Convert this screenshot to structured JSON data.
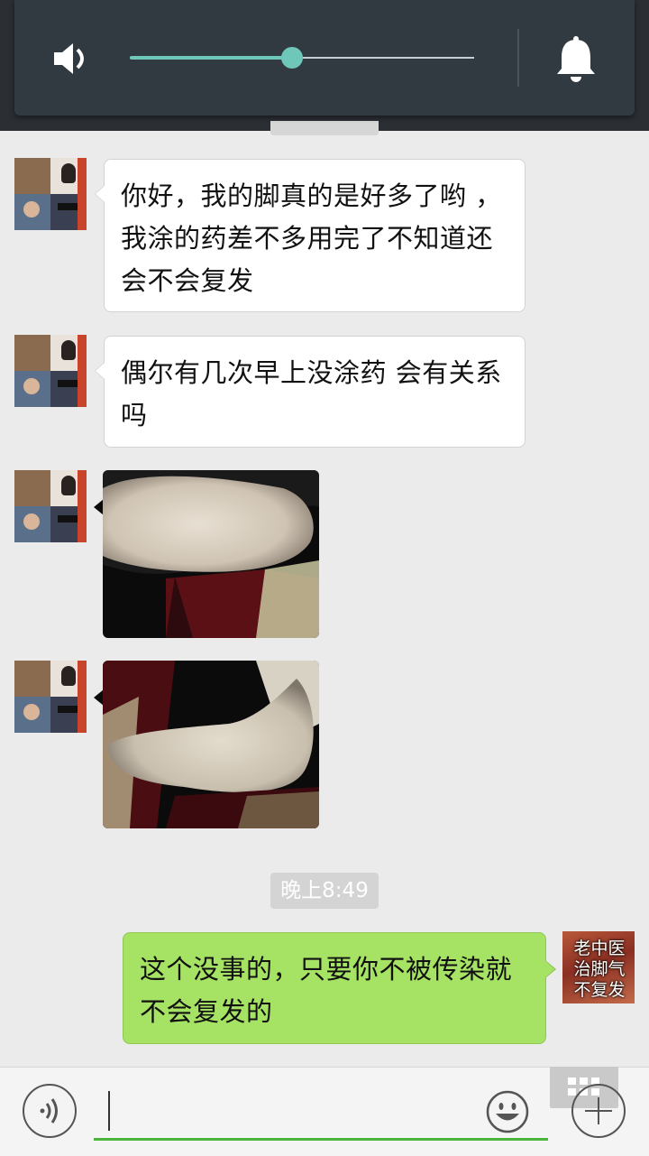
{
  "volume": {
    "level_percent": 47,
    "icon": "speaker-icon",
    "mode_icon": "bell-icon",
    "accent_color": "#6fc7b9"
  },
  "messages": [
    {
      "side": "left",
      "type": "text",
      "text": "你好，我的脚真的是好多了哟 ，我涂的药差不多用完了不知道还会不会复发"
    },
    {
      "side": "left",
      "type": "text",
      "text": "偶尔有几次早上没涂药 会有关系吗"
    },
    {
      "side": "left",
      "type": "image",
      "subject": "foot-photo"
    },
    {
      "side": "left",
      "type": "image",
      "subject": "foot-photo"
    }
  ],
  "timestamp": "晚上8:49",
  "reply": {
    "side": "right",
    "text": "这个没事的，只要你不被传染就不会复发的",
    "avatar_text": "老中医\n治脚气\n不复发",
    "bubble_color": "#a6e364"
  },
  "input_bar": {
    "voice_icon": "voice-icon",
    "emoji_icon": "emoji-icon",
    "plus_icon": "plus-icon",
    "keyboard_icon": "keyboard-icon",
    "text_value": ""
  }
}
